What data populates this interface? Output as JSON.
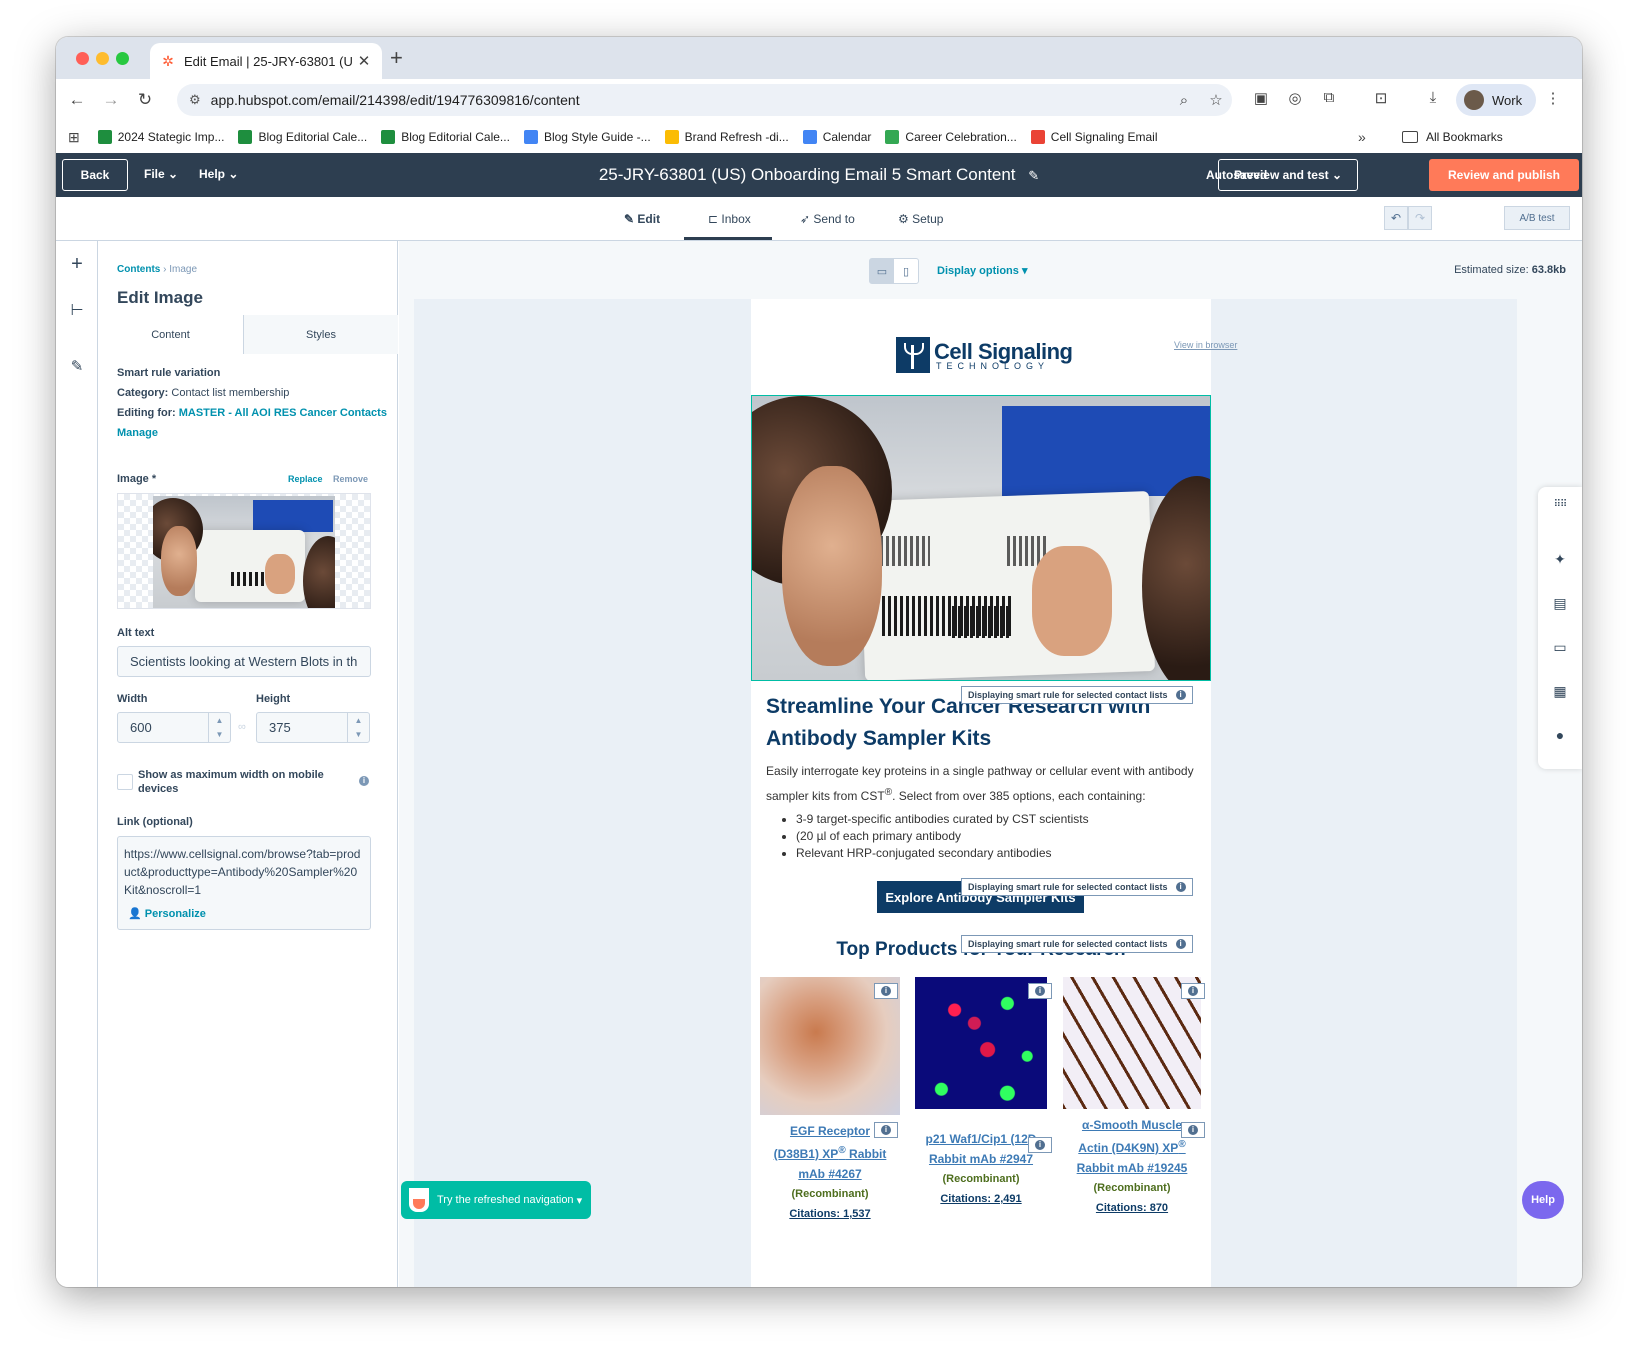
{
  "browser": {
    "tab_title": "Edit Email | 25-JRY-63801 (U",
    "url": "app.hubspot.com/email/214398/edit/194776309816/content",
    "profile_label": "Work",
    "bookmarks": [
      {
        "label": "2024 Stategic Imp...",
        "color": "#1e8e3e"
      },
      {
        "label": "Blog Editorial Cale...",
        "color": "#1e8e3e"
      },
      {
        "label": "Blog Editorial Cale...",
        "color": "#1e8e3e"
      },
      {
        "label": "Blog Style Guide -...",
        "color": "#4285f4"
      },
      {
        "label": "Brand Refresh -di...",
        "color": "#fbbc04"
      },
      {
        "label": "Calendar",
        "color": "#4285f4"
      },
      {
        "label": "Career Celebration...",
        "color": "#34a853"
      },
      {
        "label": "Cell Signaling Email",
        "color": "#ea4335"
      }
    ],
    "all_bookmarks": "All Bookmarks"
  },
  "hubspot_bar": {
    "back": "Back",
    "file": "File",
    "help": "Help",
    "title": "25-JRY-63801 (US) Onboarding Email 5 Smart Content",
    "autosaved": "Autosaved",
    "preview": "Preview and test",
    "publish": "Review and publish"
  },
  "subnav": {
    "tabs": [
      "Edit",
      "Inbox",
      "Send to",
      "Setup"
    ],
    "ab_test": "A/B test"
  },
  "panel": {
    "crumb_root": "Contents",
    "crumb_leaf": "Image",
    "title": "Edit Image",
    "tab_content": "Content",
    "tab_styles": "Styles",
    "smart_rule": "Smart rule variation",
    "category_label": "Category:",
    "category_value": "Contact list membership",
    "editing_label": "Editing for:",
    "editing_value": "MASTER - All AOI RES Cancer Contacts",
    "manage": "Manage",
    "image_label": "Image *",
    "replace": "Replace",
    "remove": "Remove",
    "alt_label": "Alt text",
    "alt_value": "Scientists looking at Western Blots in th",
    "width_label": "Width",
    "width_value": "600",
    "height_label": "Height",
    "height_value": "375",
    "mobile_label": "Show as maximum width on mobile devices",
    "link_label": "Link (optional)",
    "link_value": "https://www.cellsignal.com/browse?tab=product&producttype=Antibody%20Sampler%20Kit&noscroll=1",
    "personalize": "Personalize"
  },
  "canvas": {
    "display_options": "Display options",
    "est_label": "Estimated size:",
    "est_value": "63.8kb",
    "view_in_browser": "View in browser"
  },
  "email": {
    "logo_line1": "Cell Signaling",
    "logo_line2": "TECHNOLOGY",
    "headline": "Streamline Your Cancer Research with Antibody Sampler Kits",
    "body_1": "Easily interrogate key proteins in a single pathway or cellular event with antibody sampler kits from CST",
    "body_sup": "®",
    "body_2": ". Select from over 385 options, each containing:",
    "bullets": [
      "3-9 target-specific antibodies curated by CST scientists",
      "(20 µl of each primary antibody",
      "Relevant HRP-conjugated secondary antibodies"
    ],
    "cta": "Explore Antibody Sampler Kits",
    "smart_badge": "Displaying smart rule for selected contact lists",
    "section_title": "Top Products for Your Research",
    "products": [
      {
        "l1": "EGF Receptor",
        "l2": "(D38B1) XP",
        "sup": "®",
        "l3": " Rabbit",
        "l4": "mAb #4267",
        "rec": "(Recombinant)",
        "cit": "Citations: 1,537"
      },
      {
        "l1": "p21 Waf1/Cip1 (12D",
        "l2": "Rabbit mAb #2947",
        "rec": "(Recombinant)",
        "cit": "Citations: 2,491"
      },
      {
        "l1": "α-Smooth Muscle",
        "l2": "Actin (D4K9N) XP",
        "sup": "®",
        "l3": "Rabbit mAb #19245",
        "rec": "(Recombinant)",
        "cit": "Citations: 870"
      }
    ]
  },
  "floating": {
    "try_nav": "Try the refreshed navigation",
    "help": "Help"
  }
}
